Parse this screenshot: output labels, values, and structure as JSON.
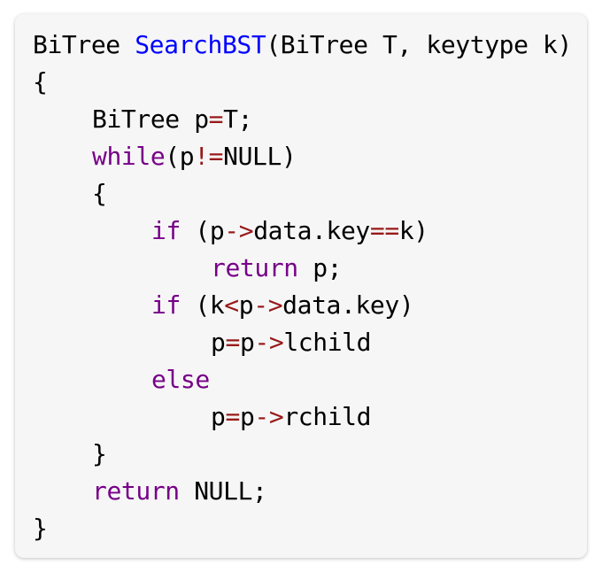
{
  "code_lines": [
    {
      "indent": 0,
      "tokens": [
        {
          "t": "BiTree ",
          "c": "plain"
        },
        {
          "t": "SearchBST",
          "c": "fn"
        },
        {
          "t": "(BiTree T, keytype k)",
          "c": "plain"
        }
      ]
    },
    {
      "indent": 0,
      "tokens": [
        {
          "t": "{",
          "c": "plain"
        }
      ]
    },
    {
      "indent": 1,
      "tokens": [
        {
          "t": "BiTree p",
          "c": "plain"
        },
        {
          "t": "=",
          "c": "op"
        },
        {
          "t": "T;",
          "c": "plain"
        }
      ]
    },
    {
      "indent": 1,
      "tokens": [
        {
          "t": "while",
          "c": "kw"
        },
        {
          "t": "(p",
          "c": "plain"
        },
        {
          "t": "!=",
          "c": "op"
        },
        {
          "t": "NULL)",
          "c": "plain"
        }
      ]
    },
    {
      "indent": 1,
      "tokens": [
        {
          "t": "{",
          "c": "plain"
        }
      ]
    },
    {
      "indent": 2,
      "tokens": [
        {
          "t": "if",
          "c": "kw"
        },
        {
          "t": " (p",
          "c": "plain"
        },
        {
          "t": "->",
          "c": "op"
        },
        {
          "t": "data.key",
          "c": "plain"
        },
        {
          "t": "==",
          "c": "op"
        },
        {
          "t": "k)",
          "c": "plain"
        }
      ]
    },
    {
      "indent": 3,
      "tokens": [
        {
          "t": "return",
          "c": "kw"
        },
        {
          "t": " p;",
          "c": "plain"
        }
      ]
    },
    {
      "indent": 2,
      "tokens": [
        {
          "t": "if",
          "c": "kw"
        },
        {
          "t": " (k",
          "c": "plain"
        },
        {
          "t": "<",
          "c": "op"
        },
        {
          "t": "p",
          "c": "plain"
        },
        {
          "t": "->",
          "c": "op"
        },
        {
          "t": "data.key)",
          "c": "plain"
        }
      ]
    },
    {
      "indent": 3,
      "tokens": [
        {
          "t": "p",
          "c": "plain"
        },
        {
          "t": "=",
          "c": "op"
        },
        {
          "t": "p",
          "c": "plain"
        },
        {
          "t": "->",
          "c": "op"
        },
        {
          "t": "lchild",
          "c": "plain"
        }
      ]
    },
    {
      "indent": 2,
      "tokens": [
        {
          "t": "else",
          "c": "kw"
        }
      ]
    },
    {
      "indent": 3,
      "tokens": [
        {
          "t": "p",
          "c": "plain"
        },
        {
          "t": "=",
          "c": "op"
        },
        {
          "t": "p",
          "c": "plain"
        },
        {
          "t": "->",
          "c": "op"
        },
        {
          "t": "rchild",
          "c": "plain"
        }
      ]
    },
    {
      "indent": 1,
      "tokens": [
        {
          "t": "}",
          "c": "plain"
        }
      ]
    },
    {
      "indent": 1,
      "tokens": [
        {
          "t": "return",
          "c": "kw"
        },
        {
          "t": " NULL;",
          "c": "plain"
        }
      ]
    },
    {
      "indent": 0,
      "tokens": [
        {
          "t": "}",
          "c": "plain"
        }
      ]
    }
  ],
  "colors": {
    "background": "#f6f6f6",
    "keyword": "#770088",
    "operator": "#981a1a",
    "function_name": "#0000ff",
    "plain": "#000000"
  }
}
